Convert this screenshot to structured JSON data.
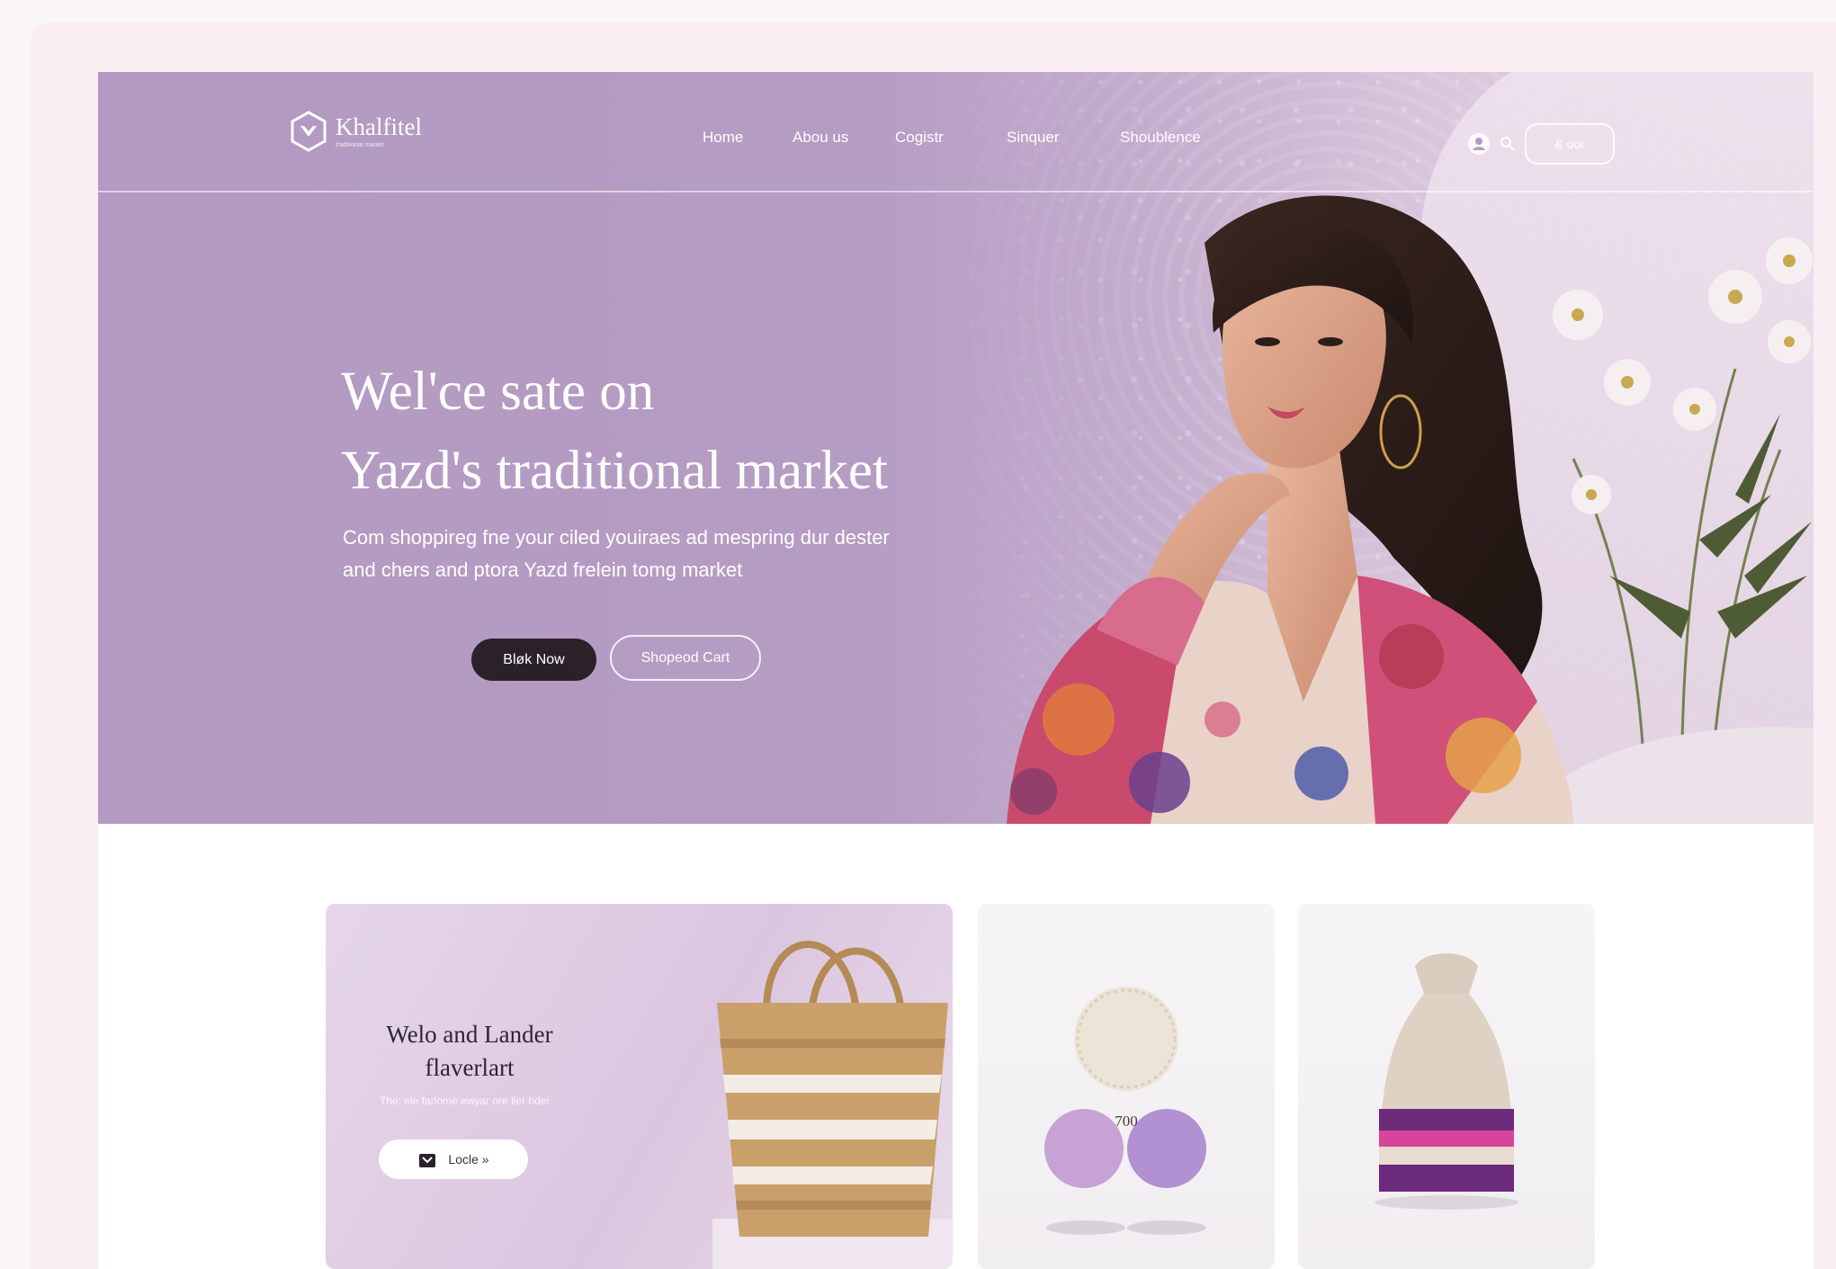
{
  "brand": {
    "name": "Khalfitel",
    "tagline": "traditional market"
  },
  "nav": {
    "items": [
      "Home",
      "Abou us",
      "Cogistr",
      "Sinquer",
      "Shoublence"
    ]
  },
  "header": {
    "signin_label": "& oor"
  },
  "hero": {
    "headline_line1": "Wel'ce sate on",
    "headline_line2": "Yazd's traditional market",
    "subtext_line1": "Com shoppireg fne your ciled youiraes ad mespring dur dester",
    "subtext_line2": "and chers and ptora Yazd frelein tomg market",
    "primary_button": "Bløk Now",
    "secondary_button": "Shopeod Cart"
  },
  "promo": {
    "title_line1": "Welo and Lander",
    "title_line2": "flaverlart",
    "subtitle": "The: ele farlome ewyar ore ller hder",
    "button_label": "Locle »"
  },
  "products": {
    "card1_label": "700"
  },
  "colors": {
    "hero_bg": "#b49ac2",
    "dark_button": "#2a2228",
    "page_bg": "#fbeef2"
  }
}
